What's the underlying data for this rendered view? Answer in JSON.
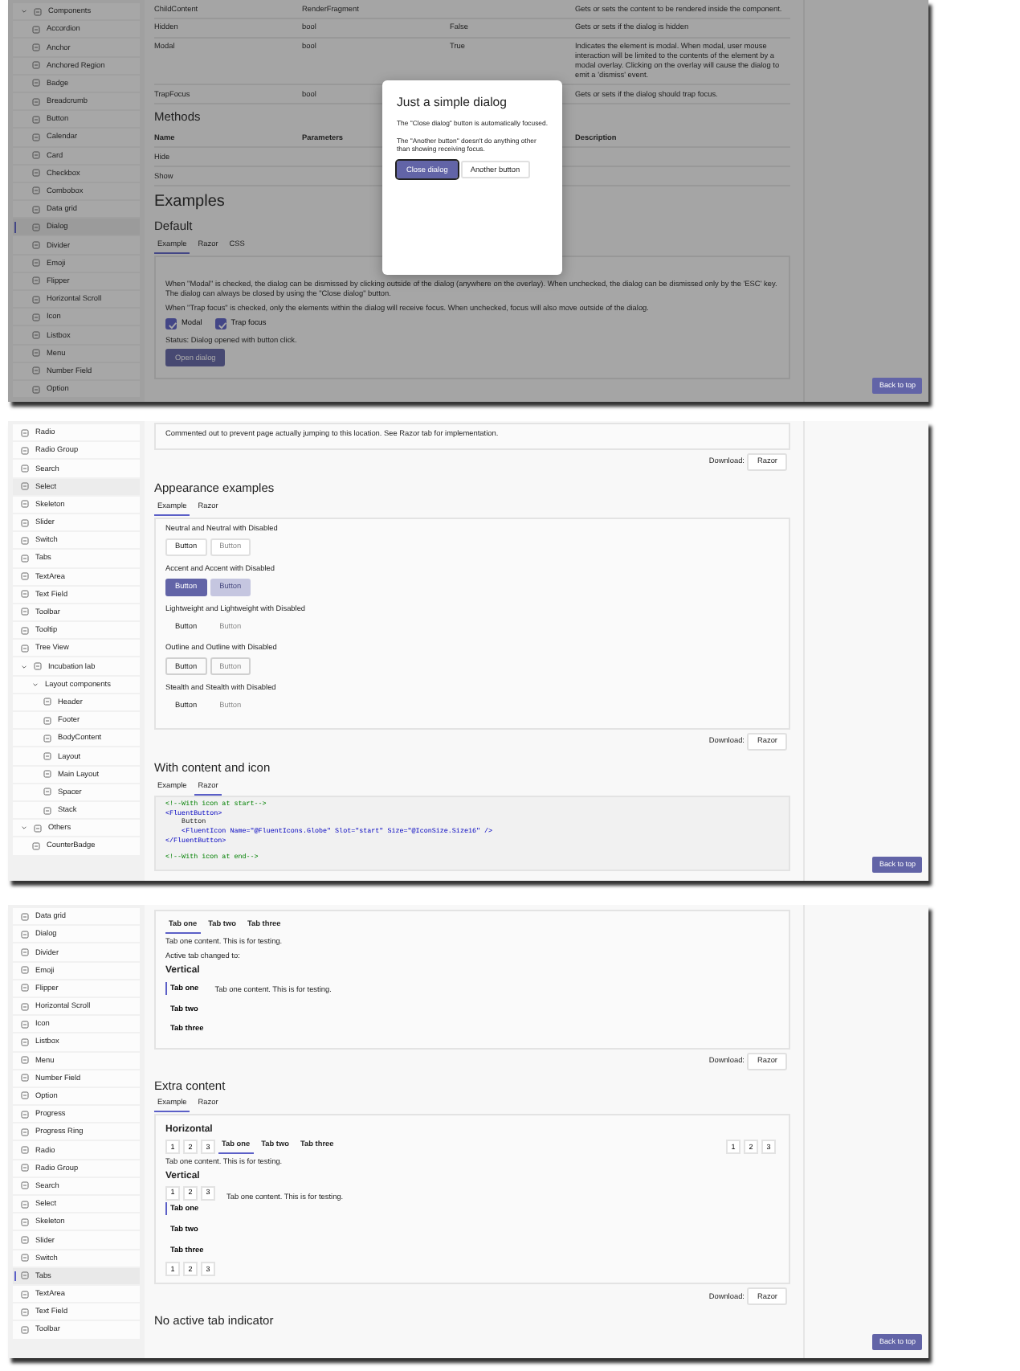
{
  "screens": [
    {
      "sidebar": [
        {
          "label": "Components",
          "expanded": true,
          "children": [
            {
              "label": "Accordion",
              "selected": false
            },
            {
              "label": "Anchor",
              "selected": false
            },
            {
              "label": "Anchored Region",
              "selected": false
            },
            {
              "label": "Badge",
              "selected": false
            },
            {
              "label": "Breadcrumb",
              "selected": false
            },
            {
              "label": "Button",
              "selected": false
            },
            {
              "label": "Calendar",
              "selected": false
            },
            {
              "label": "Card",
              "selected": false
            },
            {
              "label": "Checkbox",
              "selected": false
            },
            {
              "label": "Combobox",
              "selected": false
            },
            {
              "label": "Data grid",
              "selected": false
            },
            {
              "label": "Dialog",
              "selected": true
            },
            {
              "label": "Divider",
              "selected": false
            },
            {
              "label": "Emoji",
              "selected": false
            },
            {
              "label": "Flipper",
              "selected": false
            },
            {
              "label": "Horizontal Scroll",
              "selected": false
            },
            {
              "label": "Icon",
              "selected": false
            },
            {
              "label": "Listbox",
              "selected": false
            },
            {
              "label": "Menu",
              "selected": false
            },
            {
              "label": "Number Field",
              "selected": false
            },
            {
              "label": "Option",
              "selected": false
            }
          ]
        }
      ],
      "content": [
        {
          "kind": "table",
          "rows": [
            [
              "ChildContent",
              "RenderFragment",
              "",
              "Gets or sets the content to be rendered inside the component."
            ],
            [
              "Hidden",
              "bool",
              "False",
              "Gets or sets if the dialog is hidden"
            ],
            [
              "Modal",
              "bool",
              "True",
              "Indicates the element is modal. When modal, user mouse interaction will be limited to the contents of the element by a modal overlay. Clicking on the overlay will cause the dialog to emit a 'dismiss' event."
            ],
            [
              "TrapFocus",
              "bool",
              "",
              "Gets or sets if the dialog should trap focus."
            ]
          ]
        },
        {
          "kind": "section_heading",
          "text": "Methods"
        },
        {
          "kind": "table",
          "columns": [
            "Name",
            "Parameters",
            "Description"
          ],
          "rows": [
            [
              "Hide",
              "",
              ""
            ],
            [
              "Show",
              "",
              ""
            ]
          ]
        },
        {
          "kind": "page_heading",
          "text": "Examples"
        },
        {
          "kind": "section_heading",
          "text": "Default"
        },
        {
          "kind": "tabs",
          "tabs": [
            {
              "label": "Example",
              "selected": true
            },
            {
              "label": "Razor",
              "selected": false
            },
            {
              "label": "CSS",
              "selected": false
            }
          ]
        },
        {
          "kind": "box",
          "items": [
            {
              "kind": "text",
              "text": "When \"Modal\" is checked, the dialog can be dismissed by clicking outside of the dialog (anywhere on the overlay). When unchecked, the dialog can be dismissed only by the 'ESC' key. The dialog can always be closed by using the \"Close dialog\" button."
            },
            {
              "kind": "text",
              "text": "When \"Trap focus\" is checked, only the elements within the dialog will receive focus. When unchecked, focus will also move outside of the dialog."
            },
            {
              "kind": "checkboxes",
              "items": [
                {
                  "label": "Modal",
                  "checked": true
                },
                {
                  "label": "Trap focus",
                  "checked": true
                }
              ]
            },
            {
              "kind": "text",
              "text": "Status: Dialog opened with button click."
            },
            {
              "kind": "buttons",
              "buttons": [
                {
                  "label": "Open dialog",
                  "kind": "accent",
                  "disabled": false
                }
              ]
            }
          ]
        }
      ],
      "back_to_top": "Back to top",
      "dialog": {
        "title": "Just a simple dialog",
        "texts": [
          "The \"Close dialog\" button is automatically focused.",
          "The \"Another button\" doesn't do anything other than showing receiving focus."
        ],
        "buttons": [
          {
            "label": "Close dialog",
            "kind": "accent",
            "disabled": false
          },
          {
            "label": "Another button",
            "kind": "neutral",
            "disabled": false
          }
        ]
      }
    },
    {
      "sidebar": [
        {
          "label": "Radio",
          "highlighted": false
        },
        {
          "label": "Radio Group",
          "highlighted": false
        },
        {
          "label": "Search",
          "highlighted": false
        },
        {
          "label": "Select",
          "highlighted": true
        },
        {
          "label": "Skeleton",
          "highlighted": false
        },
        {
          "label": "Slider",
          "highlighted": false
        },
        {
          "label": "Switch",
          "highlighted": false
        },
        {
          "label": "Tabs",
          "highlighted": false
        },
        {
          "label": "TextArea",
          "highlighted": false
        },
        {
          "label": "Text Field",
          "highlighted": false
        },
        {
          "label": "Toolbar",
          "highlighted": false
        },
        {
          "label": "Tooltip",
          "highlighted": false
        },
        {
          "label": "Tree View",
          "highlighted": false
        },
        {
          "label": "Incubation lab",
          "expanded": true,
          "children": [
            {
              "label": "Layout components",
              "expanded": true,
              "children": [
                {
                  "label": "Header",
                  "highlighted": false
                },
                {
                  "label": "Footer",
                  "highlighted": false
                },
                {
                  "label": "BodyContent",
                  "highlighted": false
                },
                {
                  "label": "Layout",
                  "highlighted": false
                },
                {
                  "label": "Main Layout",
                  "highlighted": false
                },
                {
                  "label": "Spacer",
                  "highlighted": false
                },
                {
                  "label": "Stack",
                  "highlighted": false
                }
              ]
            }
          ]
        },
        {
          "label": "Others",
          "expanded": true,
          "children": [
            {
              "label": "CounterBadge",
              "highlighted": false
            }
          ]
        }
      ],
      "content": [
        {
          "kind": "box",
          "items": [
            {
              "kind": "text",
              "text": "Commented out to prevent page actually jumping to this location. See Razor tab for implementation."
            }
          ]
        },
        {
          "kind": "download",
          "label": "Download:",
          "button": "Razor"
        },
        {
          "kind": "section_heading",
          "text": "Appearance examples"
        },
        {
          "kind": "tabs",
          "tabs": [
            {
              "label": "Example",
              "selected": true
            },
            {
              "label": "Razor",
              "selected": false
            }
          ]
        },
        {
          "kind": "box",
          "items": [
            {
              "kind": "caption",
              "text": "Neutral and Neutral with Disabled"
            },
            {
              "kind": "buttons",
              "buttons": [
                {
                  "label": "Button",
                  "kind": "neutral",
                  "disabled": false
                },
                {
                  "label": "Button",
                  "kind": "neutral",
                  "disabled": true
                }
              ]
            },
            {
              "kind": "caption",
              "text": "Accent and Accent with Disabled"
            },
            {
              "kind": "buttons",
              "buttons": [
                {
                  "label": "Button",
                  "kind": "accent",
                  "disabled": false
                },
                {
                  "label": "Button",
                  "kind": "accent",
                  "disabled": true
                }
              ]
            },
            {
              "kind": "caption",
              "text": "Lightweight and Lightweight with Disabled"
            },
            {
              "kind": "buttons",
              "buttons": [
                {
                  "label": "Button",
                  "kind": "lightweight",
                  "disabled": false
                },
                {
                  "label": "Button",
                  "kind": "lightweight",
                  "disabled": true
                }
              ]
            },
            {
              "kind": "caption",
              "text": "Outline and Outline with Disabled"
            },
            {
              "kind": "buttons",
              "buttons": [
                {
                  "label": "Button",
                  "kind": "outline",
                  "disabled": false
                },
                {
                  "label": "Button",
                  "kind": "outline",
                  "disabled": true
                }
              ]
            },
            {
              "kind": "caption",
              "text": "Stealth and Stealth with Disabled"
            },
            {
              "kind": "buttons",
              "buttons": [
                {
                  "label": "Button",
                  "kind": "stealth",
                  "disabled": false
                },
                {
                  "label": "Button",
                  "kind": "stealth",
                  "disabled": true
                }
              ]
            }
          ]
        },
        {
          "kind": "download",
          "label": "Download:",
          "button": "Razor"
        },
        {
          "kind": "section_heading",
          "text": "With content and icon"
        },
        {
          "kind": "tabs",
          "tabs": [
            {
              "label": "Example",
              "selected": false
            },
            {
              "label": "Razor",
              "selected": true
            }
          ]
        },
        {
          "kind": "code",
          "lines": [
            {
              "kind": "comment",
              "text": "<!--With icon at start-->"
            },
            {
              "kind": "tag",
              "text": "<FluentButton>"
            },
            {
              "kind": "plain",
              "text": "    Button"
            },
            {
              "kind": "tag",
              "text": "    <FluentIcon Name=\"@FluentIcons.Globe\" Slot=\"start\" Size=\"@IconSize.Size16\" />"
            },
            {
              "kind": "tag",
              "text": "</FluentButton>"
            },
            {
              "kind": "comment",
              "text": "<!--With icon at end-->"
            }
          ]
        }
      ],
      "back_to_top": "Back to top"
    },
    {
      "sidebar": [
        {
          "label": "Data grid",
          "selected": false
        },
        {
          "label": "Dialog",
          "selected": false
        },
        {
          "label": "Divider",
          "selected": false
        },
        {
          "label": "Emoji",
          "selected": false
        },
        {
          "label": "Flipper",
          "selected": false
        },
        {
          "label": "Horizontal Scroll",
          "selected": false
        },
        {
          "label": "Icon",
          "selected": false
        },
        {
          "label": "Listbox",
          "selected": false
        },
        {
          "label": "Menu",
          "selected": false
        },
        {
          "label": "Number Field",
          "selected": false
        },
        {
          "label": "Option",
          "selected": false
        },
        {
          "label": "Progress",
          "selected": false
        },
        {
          "label": "Progress Ring",
          "selected": false
        },
        {
          "label": "Radio",
          "selected": false
        },
        {
          "label": "Radio Group",
          "selected": false
        },
        {
          "label": "Search",
          "selected": false
        },
        {
          "label": "Select",
          "selected": false
        },
        {
          "label": "Skeleton",
          "selected": false
        },
        {
          "label": "Slider",
          "selected": false
        },
        {
          "label": "Switch",
          "selected": false
        },
        {
          "label": "Tabs",
          "selected": true
        },
        {
          "label": "TextArea",
          "selected": false
        },
        {
          "label": "Text Field",
          "selected": false
        },
        {
          "label": "Toolbar",
          "selected": false
        }
      ],
      "content": [
        {
          "kind": "box",
          "items": [
            {
              "kind": "htabs",
              "tabs": [
                {
                  "label": "Tab one",
                  "selected": true
                },
                {
                  "label": "Tab two",
                  "selected": false
                },
                {
                  "label": "Tab three",
                  "selected": false
                }
              ]
            },
            {
              "kind": "text",
              "text": "Tab one content. This is for testing."
            },
            {
              "kind": "text",
              "text": "Active tab changed to:"
            },
            {
              "kind": "subheading",
              "text": "Vertical"
            },
            {
              "kind": "vtabs",
              "tabs": [
                {
                  "label": "Tab one",
                  "selected": true
                },
                {
                  "label": "Tab two",
                  "selected": false
                },
                {
                  "label": "Tab three",
                  "selected": false
                }
              ],
              "content": "Tab one content. This is for testing."
            }
          ]
        },
        {
          "kind": "download",
          "label": "Download:",
          "button": "Razor"
        },
        {
          "kind": "section_heading",
          "text": "Extra content"
        },
        {
          "kind": "tabs",
          "tabs": [
            {
              "label": "Example",
              "selected": true
            },
            {
              "label": "Razor",
              "selected": false
            }
          ]
        },
        {
          "kind": "box",
          "items": [
            {
              "kind": "subheading",
              "text": "Horizontal"
            },
            {
              "kind": "htabs",
              "start": [
                "1",
                "2",
                "3"
              ],
              "tabs": [
                {
                  "label": "Tab one",
                  "selected": true
                },
                {
                  "label": "Tab two",
                  "selected": false
                },
                {
                  "label": "Tab three",
                  "selected": false
                }
              ],
              "end": [
                "1",
                "2",
                "3"
              ]
            },
            {
              "kind": "text",
              "text": "Tab one content. This is for testing."
            },
            {
              "kind": "subheading",
              "text": "Vertical"
            },
            {
              "kind": "vtabs",
              "start": [
                "1",
                "2",
                "3"
              ],
              "tabs": [
                {
                  "label": "Tab one",
                  "selected": true
                },
                {
                  "label": "Tab two",
                  "selected": false
                },
                {
                  "label": "Tab three",
                  "selected": false
                }
              ],
              "content": "Tab one content. This is for testing.",
              "end": [
                "1",
                "2",
                "3"
              ]
            }
          ]
        },
        {
          "kind": "download",
          "label": "Download:",
          "button": "Razor"
        },
        {
          "kind": "section_heading",
          "text": "No active tab indicator"
        }
      ],
      "back_to_top": "Back to top"
    }
  ]
}
